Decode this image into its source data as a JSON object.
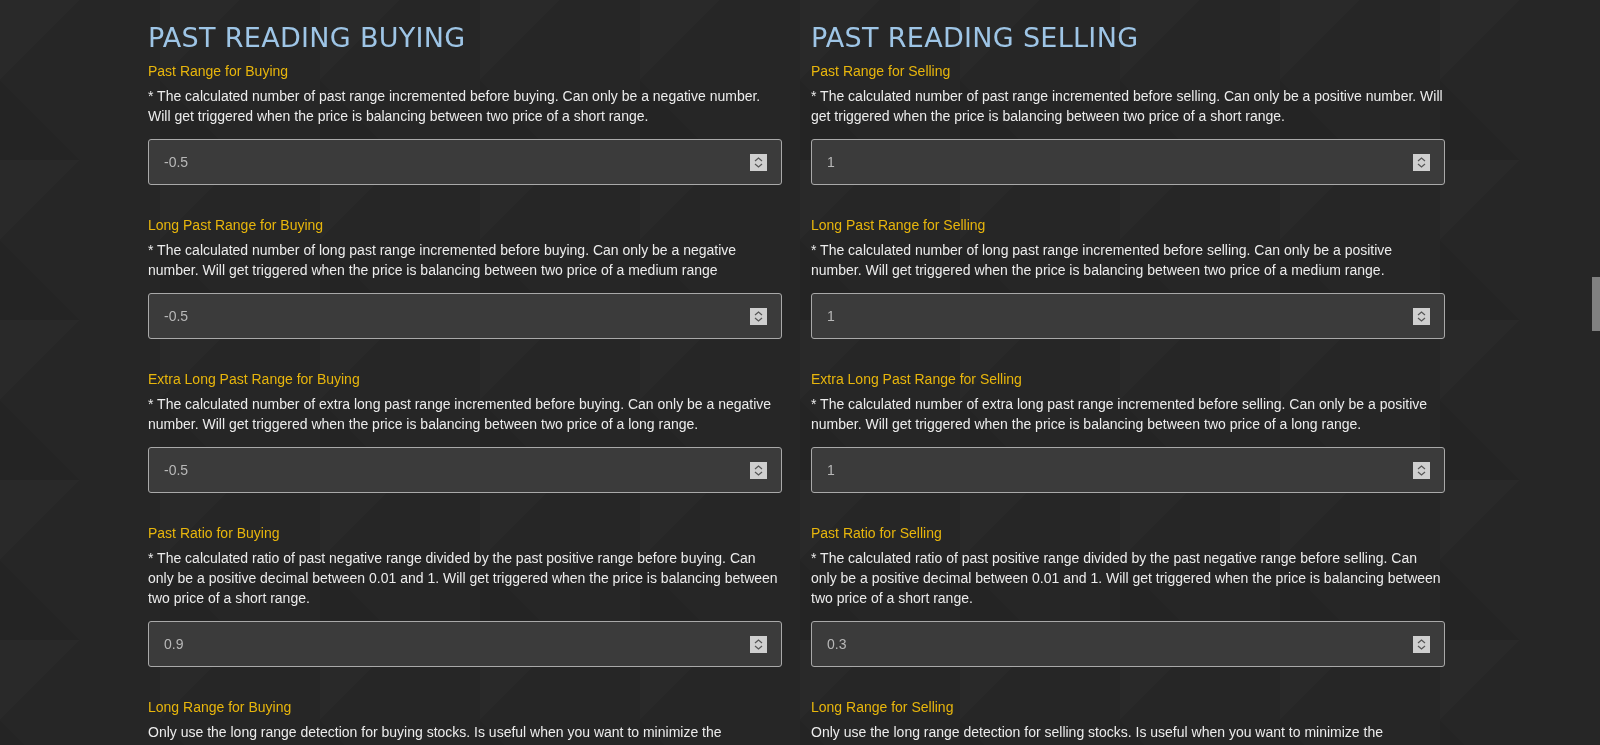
{
  "columns": [
    {
      "title": "PAST READING BUYING",
      "fields": [
        {
          "label": "Past Range for Buying",
          "description": "* The calculated number of past range incremented before buying. Can only be a negative number. Will get triggered when the price is balancing between two price of a short range.",
          "value": "-0.5"
        },
        {
          "label": "Long Past Range for Buying",
          "description": "* The calculated number of long past range incremented before buying. Can only be a negative number. Will get triggered when the price is balancing between two price of a medium range",
          "value": "-0.5"
        },
        {
          "label": "Extra Long Past Range for Buying",
          "description": "* The calculated number of extra long past range incremented before buying. Can only be a negative number. Will get triggered when the price is balancing between two price of a long range.",
          "value": "-0.5"
        },
        {
          "label": "Past Ratio for Buying",
          "description": "* The calculated ratio of past negative range divided by the past positive range before buying. Can only be a positive decimal between 0.01 and 1. Will get triggered when the price is balancing between two price of a short range.",
          "value": "0.9"
        },
        {
          "label": "Long Range for Buying",
          "description": "Only use the long range detection for buying stocks. Is useful when you want to minimize the"
        }
      ]
    },
    {
      "title": "PAST READING SELLING",
      "fields": [
        {
          "label": "Past Range for Selling",
          "description": "* The calculated number of past range incremented before selling. Can only be a positive number. Will get triggered when the price is balancing between two price of a short range.",
          "value": "1"
        },
        {
          "label": "Long Past Range for Selling",
          "description": "* The calculated number of long past range incremented before selling. Can only be a positive number. Will get triggered when the price is balancing between two price of a medium range.",
          "value": "1"
        },
        {
          "label": "Extra Long Past Range for Selling",
          "description": "* The calculated number of extra long past range incremented before selling. Can only be a positive number. Will get triggered when the price is balancing between two price of a long range.",
          "value": "1"
        },
        {
          "label": "Past Ratio for Selling",
          "description": "* The calculated ratio of past positive range divided by the past negative range before selling. Can only be a positive decimal between 0.01 and 1. Will get triggered when the price is balancing between two price of a short range.",
          "value": "0.3"
        },
        {
          "label": "Long Range for Selling",
          "description": "Only use the long range detection for selling stocks. Is useful when you want to minimize the"
        }
      ]
    }
  ]
}
